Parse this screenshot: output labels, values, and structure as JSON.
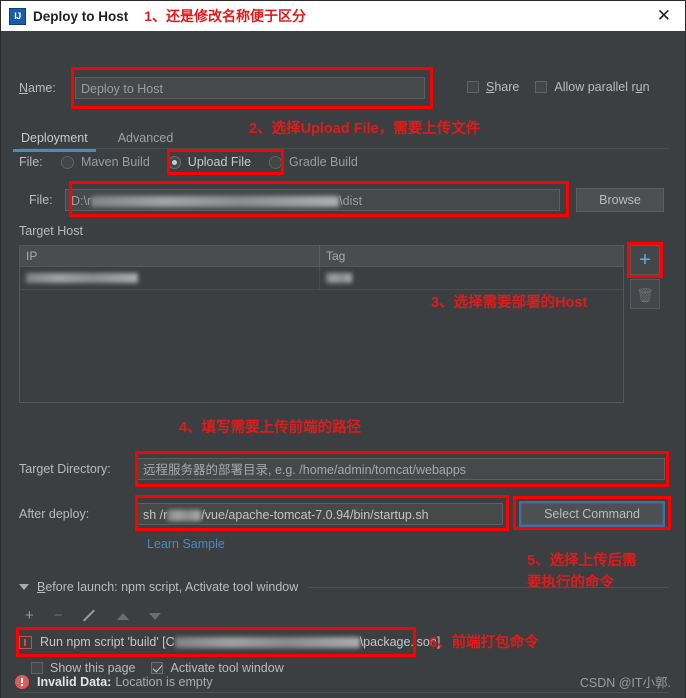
{
  "window": {
    "title": "Deploy to Host",
    "app_icon": "intellij-idea-icon",
    "close_icon": "close-icon"
  },
  "annotations": [
    {
      "id": 1,
      "text": "1、还是修改名称便于区分"
    },
    {
      "id": 2,
      "text": "2、选择Upload File，需要上传文件"
    },
    {
      "id": 3,
      "text": "3、选择需要部署的Host"
    },
    {
      "id": 4,
      "text": "4、填写需要上传前端的路径"
    },
    {
      "id": 5,
      "line1": "5、选择上传后需",
      "line2": "要执行的命令"
    },
    {
      "id": 6,
      "text": "6、前端打包命令"
    }
  ],
  "name_row": {
    "label": "Name:",
    "label_mnemonic": "N",
    "label_rest": "ame:",
    "value": "Deploy to Host",
    "share": {
      "label": "Share",
      "mnemonic": "S",
      "rest": "hare",
      "checked": false
    },
    "allow_parallel": {
      "label_a": "Allow parallel r",
      "mnemonic": "u",
      "label_b": "n",
      "checked": false
    }
  },
  "tabs": [
    {
      "label": "Deployment",
      "active": true
    },
    {
      "label": "Advanced",
      "active": false
    }
  ],
  "file_type_row": {
    "label": "File:",
    "options": [
      {
        "label": "Maven Build",
        "selected": false
      },
      {
        "label": "Upload File",
        "selected": true
      },
      {
        "label": "Gradle Build",
        "selected": false
      }
    ]
  },
  "file_row": {
    "label": "File:",
    "value_prefix": "D:\\r",
    "value_redacted": true,
    "value_suffix": "\\dist",
    "browse_label": "Browse"
  },
  "target_host": {
    "section_label": "Target Host",
    "columns": [
      "IP",
      "Tag"
    ],
    "rows": [
      {
        "ip_redacted": true,
        "tag_redacted": true
      }
    ],
    "add_icon": "plus-icon",
    "delete_icon": "trash-icon"
  },
  "target_directory": {
    "label": "Target Directory:",
    "placeholder": "远程服务器的部署目录, e.g. /home/admin/tomcat/webapps",
    "value": ""
  },
  "after_deploy": {
    "label": "After deploy:",
    "value_prefix": "sh /r",
    "value_redacted": true,
    "value_suffix": "/vue/apache-tomcat-7.0.94/bin/startup.sh",
    "select_command_label": "Select Command",
    "learn_sample_label": "Learn Sample"
  },
  "before_launch": {
    "header_mnemonic": "B",
    "header_rest": "efore launch: npm script, Activate tool window",
    "collapse_icon": "triangle-down-icon",
    "toolbar": [
      {
        "icon": "plus-icon",
        "enabled": true
      },
      {
        "icon": "minus-icon",
        "enabled": false
      },
      {
        "icon": "pencil-icon",
        "enabled": false
      },
      {
        "icon": "arrow-up-icon",
        "enabled": false
      },
      {
        "icon": "arrow-down-icon",
        "enabled": false
      }
    ],
    "task": {
      "icon": "npm-icon",
      "text_prefix": "Run npm script 'build' [C",
      "text_redacted": true,
      "text_suffix": "\\package.json]"
    },
    "show_this_page": {
      "label": "Show this page",
      "checked": false
    },
    "activate_tool_window": {
      "label": "Activate tool window",
      "checked": true
    }
  },
  "status_bar": {
    "error_icon": "error-icon",
    "error_title": "Invalid Data:",
    "error_message": "Location is empty",
    "watermark": "CSDN @IT小郭."
  },
  "colors": {
    "annotation_red": "#e01b1b",
    "highlight_box": "#ff0000",
    "accent_blue": "#4a88c7",
    "window_bg": "#3c3f41",
    "field_bg": "#45494a",
    "error_red": "#db5c5c"
  }
}
